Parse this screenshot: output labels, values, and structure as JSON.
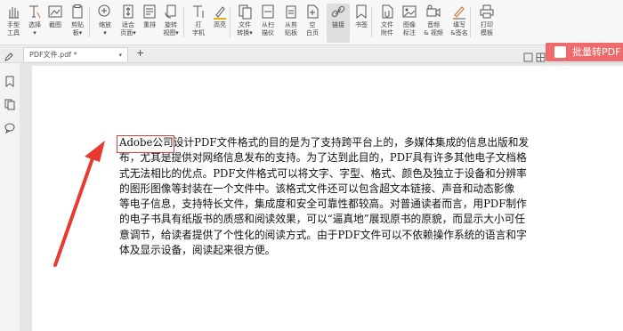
{
  "toolbar": {
    "items": [
      {
        "label": "手型\n工具",
        "icon": "hand-icon"
      },
      {
        "label": "选择\n▾",
        "icon": "text-select-icon"
      },
      {
        "label": "截图",
        "icon": "screenshot-icon"
      },
      {
        "label": "剪贴\n板▾",
        "icon": "clipboard-icon"
      },
      {
        "label": "缩放\n▾",
        "icon": "zoom-icon"
      },
      {
        "label": "适合\n页面▾",
        "icon": "fit-page-icon"
      },
      {
        "label": "重排",
        "icon": "reflow-icon"
      },
      {
        "label": "旋转\n视图▾",
        "icon": "rotate-view-icon"
      },
      {
        "label": "打\n字机",
        "icon": "typewriter-icon"
      },
      {
        "label": "高亮",
        "icon": "highlight-icon"
      },
      {
        "label": "文件\n转换▾",
        "icon": "file-convert-icon"
      },
      {
        "label": "从扫\n描仪",
        "icon": "scanner-icon"
      },
      {
        "label": "从剪\n贴板",
        "icon": "from-clipboard-icon"
      },
      {
        "label": "空\n白页",
        "icon": "blank-page-icon"
      },
      {
        "label": "链接",
        "icon": "link-icon"
      },
      {
        "label": "书签",
        "icon": "bookmark-icon"
      },
      {
        "label": "文件\n附件",
        "icon": "attachment-icon"
      },
      {
        "label": "图像\n标注",
        "icon": "image-annotation-icon"
      },
      {
        "label": "音频\n& 视频",
        "icon": "audio-video-icon"
      },
      {
        "label": "填写\n&签名",
        "icon": "fill-sign-icon"
      },
      {
        "label": "打印\n模板",
        "icon": "print-template-icon"
      }
    ]
  },
  "tabs": {
    "doc_title": "PDF文件.pdf *",
    "new_tab": "+"
  },
  "batch_button": {
    "label": "批量转PDF",
    "badge": "PDF"
  },
  "document": {
    "lines": [
      {
        "highlight": "Adobe公司",
        "rest": "设计PDF文件格式的目的是为了支持跨平台上的，多媒体集成的信息出版和发"
      },
      {
        "text": "布，尤其是提供对网络信息发布的支持。为了达到此目的，PDF具有许多其他电子文档格"
      },
      {
        "text": "式无法相比的优点。PDF文件格式可以将文字、字型、格式、颜色及独立于设备和分辨率"
      },
      {
        "text": "的图形图像等封装在一个文件中。该格式文件还可以包含超文本链接、声音和动态影像"
      },
      {
        "text": "等电子信息，支持特长文件，集成度和安全可靠性都较高。对普通读者而言，用PDF制作"
      },
      {
        "text": "的电子书具有纸版书的质感和阅读效果，可以“逼真地”展现原书的原貌，而显示大小可任"
      },
      {
        "text": "意调节，给读者提供了个性化的阅读方式。由于PDF文件可以不依赖操作系统的语言和字"
      },
      {
        "text": "体及显示设备，阅读起来很方便。"
      }
    ]
  },
  "colors": {
    "accent_red": "#ef6a6a",
    "annotation_red": "#e83a2e"
  }
}
